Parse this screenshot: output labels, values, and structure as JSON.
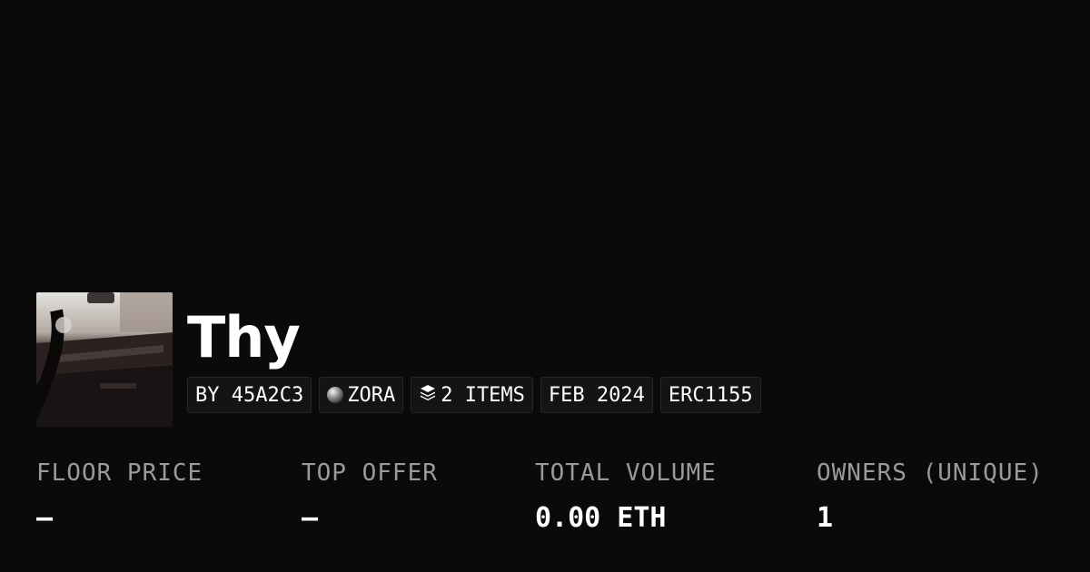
{
  "collection": {
    "title": "Thy",
    "creator": "BY 45A2C3",
    "chain": "ZORA",
    "items": "2 ITEMS",
    "date": "FEB 2024",
    "standard": "ERC1155",
    "chain_icon": "zora-orb-icon",
    "items_icon": "layers-icon"
  },
  "stats": [
    {
      "label": "FLOOR PRICE",
      "value": "–"
    },
    {
      "label": "TOP OFFER",
      "value": "–"
    },
    {
      "label": "TOTAL VOLUME",
      "value": "0.00 ETH"
    },
    {
      "label": "OWNERS (UNIQUE)",
      "value": "1"
    }
  ],
  "colors": {
    "background": "#0a0a0a",
    "label": "#9a9a9a",
    "value": "#ffffff"
  }
}
